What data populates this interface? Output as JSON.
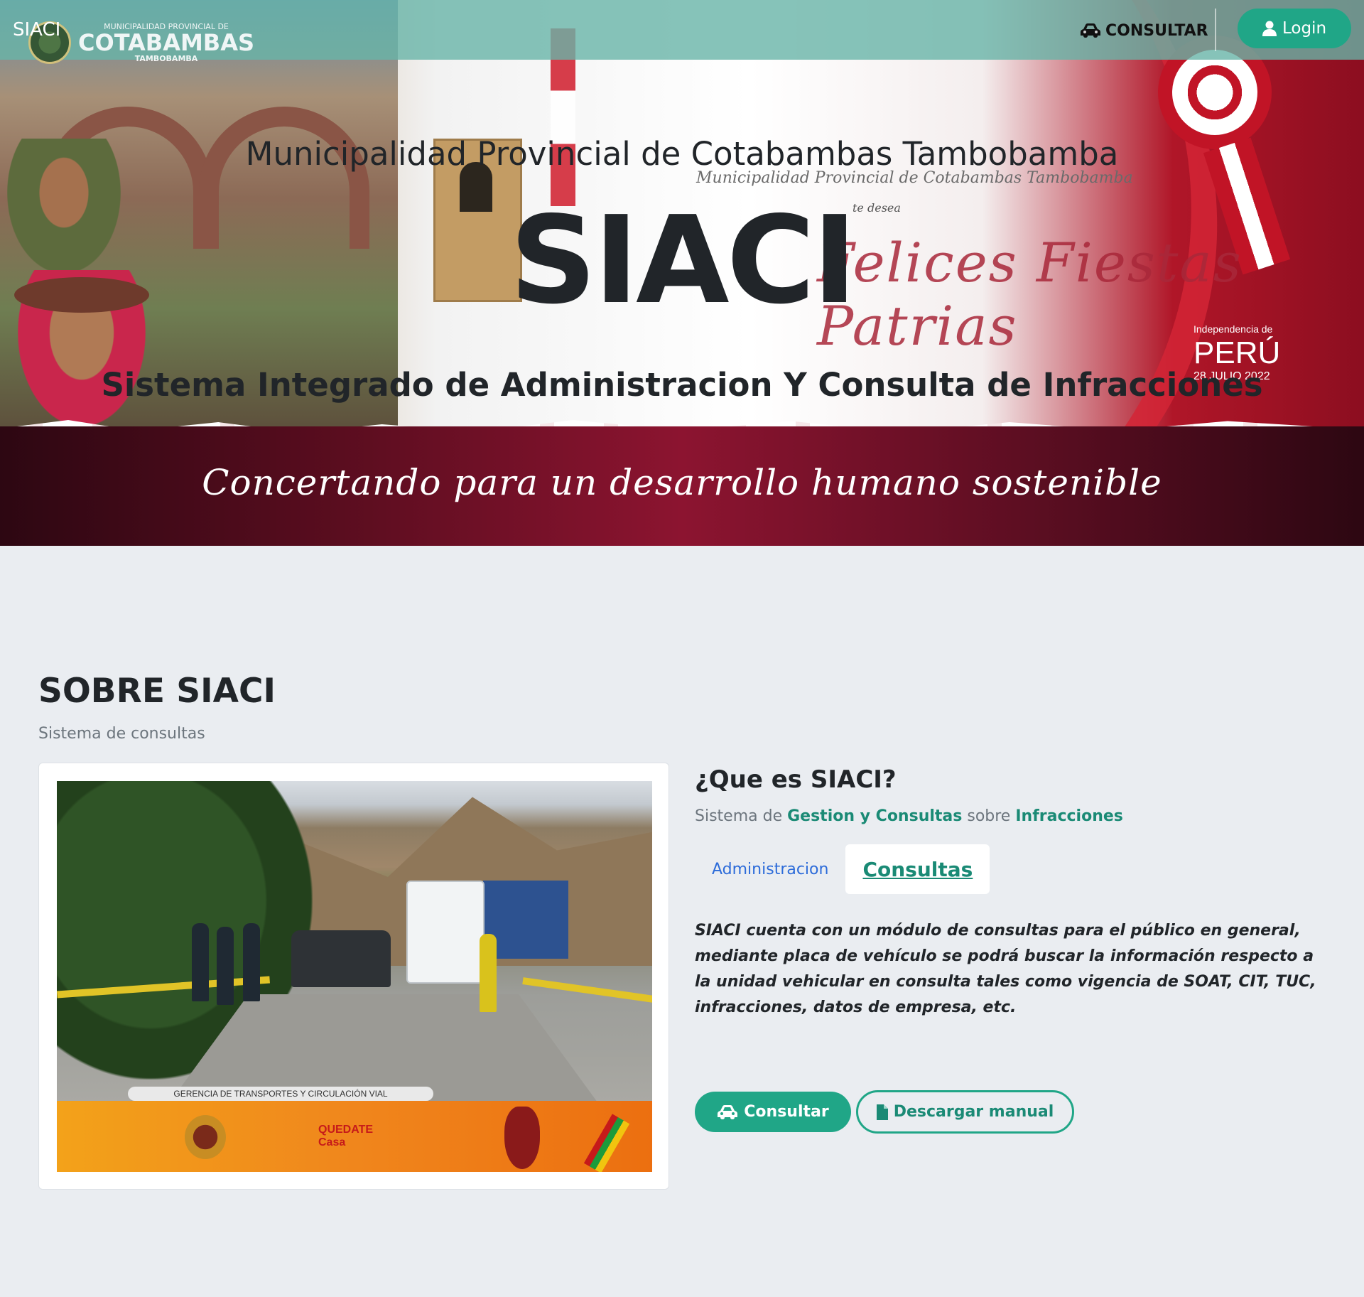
{
  "navbar": {
    "brand": "SIACI",
    "logo": {
      "line1": "MUNICIPALIDAD PROVINCIAL DE",
      "line2": "COTABAMBAS",
      "line3": "TAMBOBAMBA"
    },
    "consultar_label": "CONSULTAR",
    "login_label": "Login",
    "accent": "#20a687"
  },
  "hero": {
    "municipality": "Municipalidad Provincial de Cotabambas Tambobamba",
    "title": "SIACI",
    "subtitle": "Sistema Integrado de Administracion Y Consulta de Infracciones",
    "banner": {
      "script_line": "Municipalidad Provincial de Cotabambas Tambobamba",
      "tu_desea": "te desea",
      "wish": "Felices Fiestas Patrias",
      "independencia": "Independencia de",
      "country": "PERÚ",
      "date": "28 JULIO 2022",
      "slogan": "Concertando para un desarrollo humano sostenible"
    }
  },
  "about": {
    "title": "SOBRE SIACI",
    "subtitle": "Sistema de consultas",
    "photo": {
      "banner_label": "GERENCIA DE TRANSPORTES Y CIRCULACIÓN VIAL",
      "logo_text": "QUEDATE Casa"
    },
    "what_title": "¿Que es SIACI?",
    "what_desc": {
      "prefix": "Sistema de",
      "highlight1": "Gestion y Consultas",
      "middle": "sobre",
      "highlight2": "Infracciones"
    },
    "tabs": [
      {
        "label": "Administracion",
        "active": false
      },
      {
        "label": "Consultas",
        "active": true
      }
    ],
    "tab_content": "SIACI cuenta con un módulo de consultas para el público en general, mediante placa de vehículo se podrá buscar la información respecto a la unidad vehicular en consulta tales como vigencia de SOAT, CIT, TUC, infracciones, datos de empresa, etc.",
    "buttons": {
      "consultar": "Consultar",
      "manual": "Descargar manual"
    }
  },
  "icons": {
    "car": "car-icon",
    "user": "user-icon",
    "file": "file-icon"
  }
}
